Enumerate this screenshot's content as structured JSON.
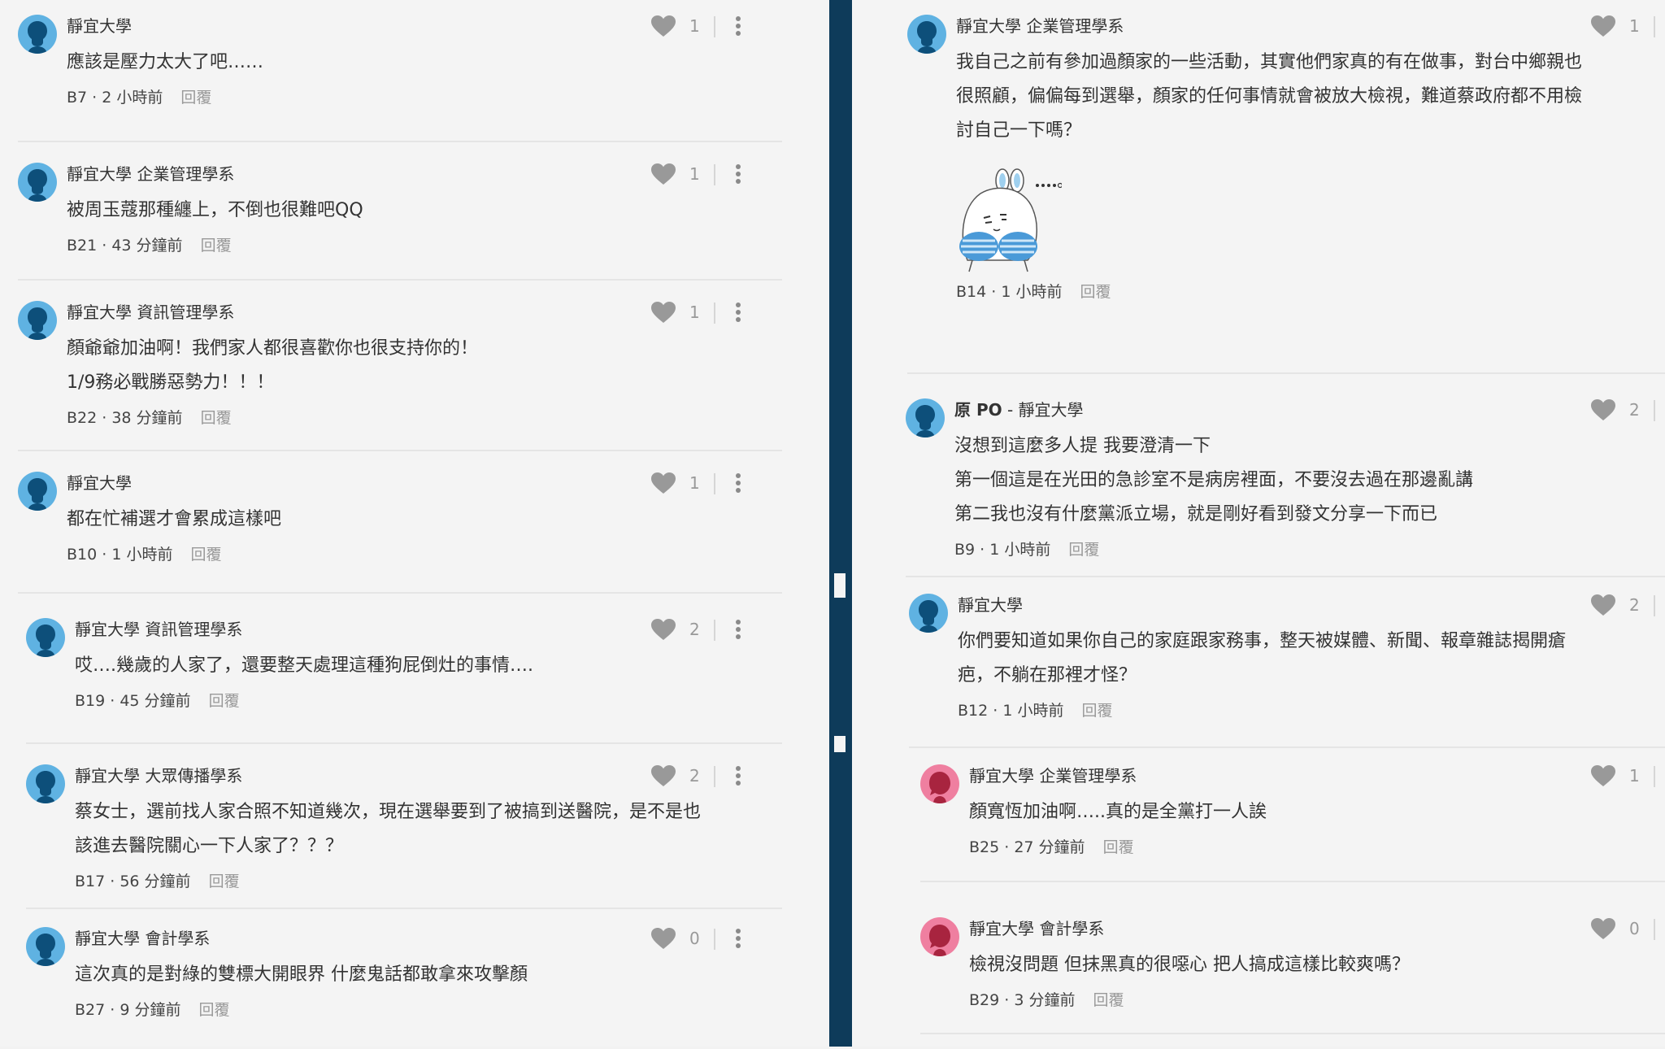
{
  "ui": {
    "reply_label": "回覆"
  },
  "left": [
    {
      "author": "靜宜大學",
      "lines": [
        "應該是壓力太大了吧……"
      ],
      "floor": "B7",
      "time": "2 小時前",
      "likes": "1",
      "avatar": "male"
    },
    {
      "author": "靜宜大學 企業管理學系",
      "lines": [
        "被周玉蔻那種纏上，不倒也很難吧QQ"
      ],
      "floor": "B21",
      "time": "43 分鐘前",
      "likes": "1",
      "avatar": "male"
    },
    {
      "author": "靜宜大學 資訊管理學系",
      "lines": [
        "顏爺爺加油啊！我們家人都很喜歡你也很支持你的！",
        "1/9務必戰勝惡勢力！！！"
      ],
      "floor": "B22",
      "time": "38 分鐘前",
      "likes": "1",
      "avatar": "male"
    },
    {
      "author": "靜宜大學",
      "lines": [
        "都在忙補選才會累成這樣吧"
      ],
      "floor": "B10",
      "time": "1 小時前",
      "likes": "1",
      "avatar": "male"
    },
    {
      "author": "靜宜大學 資訊管理學系",
      "lines": [
        "哎….幾歲的人家了，還要整天處理這種狗屁倒灶的事情…."
      ],
      "floor": "B19",
      "time": "45 分鐘前",
      "likes": "2",
      "avatar": "male"
    },
    {
      "author": "靜宜大學 大眾傳播學系",
      "lines": [
        "蔡女士，選前找人家合照不知道幾次，現在選舉要到了被搞到送醫院，是不是也",
        "該進去醫院關心一下人家了？？？"
      ],
      "floor": "B17",
      "time": "56 分鐘前",
      "likes": "2",
      "avatar": "male"
    },
    {
      "author": "靜宜大學 會計學系",
      "lines": [
        "這次真的是對綠的雙標大開眼界 什麼鬼話都敢拿來攻擊顏"
      ],
      "floor": "B27",
      "time": "9 分鐘前",
      "likes": "0",
      "avatar": "male"
    }
  ],
  "right": [
    {
      "author": "靜宜大學 企業管理學系",
      "lines": [
        "我自己之前有參加過顏家的一些活動，其實他們家真的有在做事，對台中鄉親也",
        "很照顧，偏偏每到選舉，顏家的任何事情就會被放大檢視，難道蔡政府都不用檢",
        "討自己一下嗎？"
      ],
      "floor": "B14",
      "time": "1 小時前",
      "likes": "1",
      "avatar": "male",
      "sticker": "shy-bunny-sticker"
    },
    {
      "author_prefix": "原 PO",
      "author": " - 靜宜大學",
      "lines": [
        "沒想到這麼多人提 我要澄清一下",
        "第一個這是在光田的急診室不是病房裡面，不要沒去過在那邊亂講",
        "第二我也沒有什麼黨派立場，就是剛好看到發文分享一下而已"
      ],
      "floor": "B9",
      "time": "1 小時前",
      "likes": "2",
      "avatar": "male"
    },
    {
      "author": "靜宜大學",
      "lines": [
        "你們要知道如果你自己的家庭跟家務事，整天被媒體、新聞、報章雜誌揭開瘡",
        "疤，不躺在那裡才怪？"
      ],
      "floor": "B12",
      "time": "1 小時前",
      "likes": "2",
      "avatar": "male"
    },
    {
      "author": "靜宜大學 企業管理學系",
      "lines": [
        "顏寬恆加油啊…..真的是全黨打一人誒"
      ],
      "floor": "B25",
      "time": "27 分鐘前",
      "likes": "1",
      "avatar": "female"
    },
    {
      "author": "靜宜大學 會計學系",
      "lines": [
        "檢視沒問題 但抹黑真的很噁心 把人搞成這樣比較爽嗎？"
      ],
      "floor": "B29",
      "time": "3 分鐘前",
      "likes": "0",
      "avatar": "female"
    }
  ],
  "colors": {
    "divider": "#0e3b5a",
    "avatar_male": "#5fb2e2",
    "avatar_female": "#ef7fa0",
    "heart": "#999999"
  }
}
